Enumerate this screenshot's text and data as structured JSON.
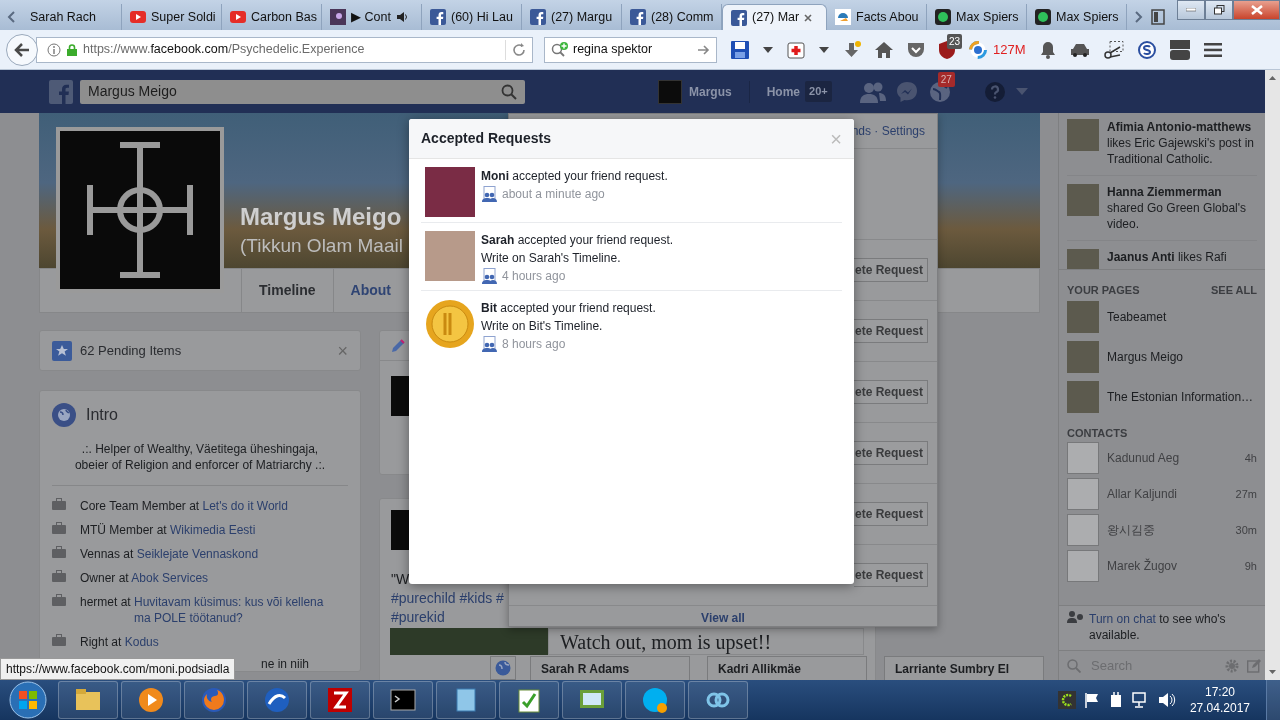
{
  "browser": {
    "tabs": [
      {
        "label": "Sarah Rach",
        "kind": "plain",
        "selected": false
      },
      {
        "label": "Super Soldi",
        "kind": "youtube",
        "selected": false
      },
      {
        "label": "Carbon Bas",
        "kind": "youtube",
        "selected": false
      },
      {
        "label": "▶ Cont",
        "kind": "media",
        "selected": false
      },
      {
        "label": "(60) Hi Lau",
        "kind": "facebook",
        "selected": false
      },
      {
        "label": "(27) Margu",
        "kind": "facebook",
        "selected": false
      },
      {
        "label": "(28) Comm",
        "kind": "facebook",
        "selected": false
      },
      {
        "label": "(27) Mar",
        "kind": "facebook",
        "selected": true
      },
      {
        "label": "Facts Abou",
        "kind": "site",
        "selected": false
      },
      {
        "label": "Max Spiers",
        "kind": "green",
        "selected": false
      },
      {
        "label": "Max Spiers",
        "kind": "green",
        "selected": false
      }
    ],
    "url": {
      "scheme": "https://www.",
      "domain": "facebook.com",
      "path": "/Psychedelic.Experience"
    },
    "search_value": "regina spektor",
    "ublock_count": "23",
    "memory": "127M"
  },
  "facebook": {
    "search_value": "Margus Meigo",
    "user": "Margus",
    "home": "Home",
    "home_count": "20+",
    "notifications": "27"
  },
  "profile": {
    "name": "Margus Meigo",
    "subtitle": "(Tikkun Olam Maail",
    "tabs": [
      {
        "label": "Timeline",
        "selected": true
      },
      {
        "label": "About",
        "selected": false
      }
    ]
  },
  "pending": {
    "label": "62 Pending Items",
    "close": "×"
  },
  "intro": {
    "title": "Intro",
    "bio": ".:. Helper of Wealthy, Väetitega üheshingaja, obeier of Religion and enforcer of Matriarchy .:.",
    "items": [
      {
        "text": "Core Team Member at ",
        "link": "Let's do it World"
      },
      {
        "text": "MTÜ Member at ",
        "link": "Wikimedia Eesti"
      },
      {
        "text": "Vennas at ",
        "link": "Seiklejate Vennaskond"
      },
      {
        "text": "Owner at ",
        "link": "Abok Services"
      },
      {
        "text": "hermet at ",
        "link": "Huvitavam küsimus: kus või kellena ma POLE töötanud?"
      },
      {
        "text": "Right at ",
        "link": "Kodus"
      }
    ],
    "partial_item": "ne in niih"
  },
  "feed": {
    "post_text": "\"W",
    "hashtags": [
      "#purechild #kids #",
      "#purekid"
    ],
    "preview_title": "Watch out, mom is upset!!"
  },
  "friend_requests": {
    "header": "nds · Settings",
    "buttons": [
      "ete Request",
      "ete Request",
      "ete Request",
      "ete Request",
      "ete Request",
      "ete Request"
    ],
    "footer": "View all"
  },
  "modal": {
    "title": "Accepted Requests",
    "close": "×",
    "items": [
      {
        "message": "**Moni** accepted your friend request.",
        "time": "about a minute ago",
        "kind": "photo"
      },
      {
        "message": "**Sarah** accepted your friend request.",
        "action": "Write on Sarah's Timeline.",
        "time": "4 hours ago",
        "kind": "photo"
      },
      {
        "message": "**Bit** accepted your friend request.",
        "action": "Write on Bit's Timeline.",
        "time": "8 hours ago",
        "kind": "coin"
      }
    ]
  },
  "sidebar": {
    "ticker": [
      "**Afimia Antonio-matthews** likes Eric Gajewski's post in Traditional Catholic.",
      "**Hanna Ziemmerman** shared Go Green Global's video.",
      "**Jaanus Anti** likes Rafi"
    ],
    "pages_title": "YOUR PAGES",
    "see_all": "SEE ALL",
    "pages": [
      "Teabeamet",
      "Margus Meigo",
      "The Estonian Information…"
    ],
    "contacts_title": "CONTACTS",
    "contacts": [
      {
        "name": "Kadunud Aeg",
        "time": "4h"
      },
      {
        "name": "Allar Kaljundi",
        "time": "27m"
      },
      {
        "name": "왕시김중",
        "time": "30m"
      },
      {
        "name": "Marek Žugov",
        "time": "9h"
      }
    ],
    "chat_link": "Turn on chat",
    "chat_text": "to see who's available.",
    "search_placeholder": "Search"
  },
  "chat_tabs": [
    "Sarah R Adams",
    "Kadri Allikmäe",
    "Larriante Sumbry El"
  ],
  "status_url": "https://www.facebook.com/moni.podsiadla",
  "taskbar": {
    "apps": [
      {
        "kind": "folder"
      },
      {
        "kind": "media"
      },
      {
        "kind": "firefox"
      },
      {
        "kind": "swirl"
      },
      {
        "kind": "filezilla"
      },
      {
        "kind": "terminal"
      },
      {
        "kind": "notebook"
      },
      {
        "kind": "notepad"
      },
      {
        "kind": "network"
      },
      {
        "kind": "skype"
      },
      {
        "kind": "link"
      }
    ],
    "time": "17:20",
    "date": "27.04.2017"
  }
}
